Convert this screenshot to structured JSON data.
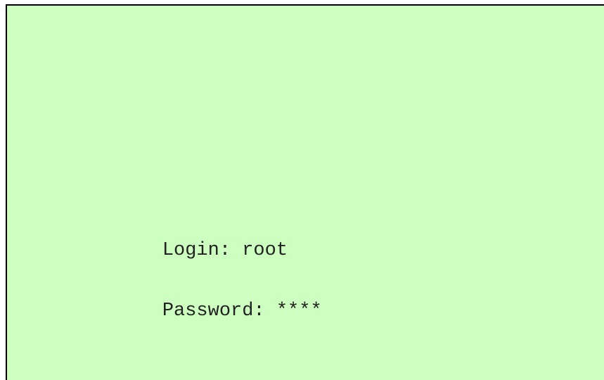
{
  "theme": {
    "background_color": "#ccffc0",
    "text_color": "#222222",
    "border_color": "#000000"
  },
  "login": {
    "label": "Login: ",
    "value": "root"
  },
  "password": {
    "label": "Password: ",
    "value": "****"
  }
}
